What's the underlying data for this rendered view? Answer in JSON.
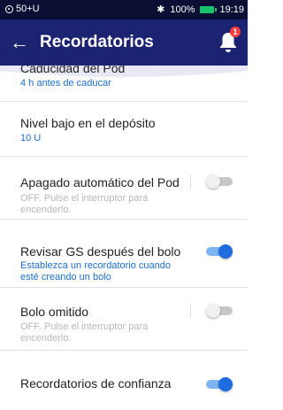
{
  "status_bar": {
    "left_text": "50+U",
    "bluetooth": "✱",
    "battery_pct": "100%",
    "time": "19:19",
    "accent": "#0b0f33"
  },
  "app_bar": {
    "title": "Recordatorios",
    "back_icon": "←",
    "notification_count": "1",
    "accent": "#1c2472"
  },
  "items": [
    {
      "title": "Caducidad del Pod",
      "subtitle": "4 h antes de caducar",
      "subtitle_color": "#1c6dd0"
    },
    {
      "title": "Nivel bajo en el depósito",
      "subtitle": "10 U",
      "subtitle_color": "#1c6dd0"
    },
    {
      "title": "Apagado automático del Pod",
      "subtitle": "OFF. Pulse el interruptor para encenderlo.",
      "toggle": "off"
    },
    {
      "title": "Revisar GS después del bolo",
      "subtitle": "Establezca un recordatorio cuando esté creando un bolo",
      "toggle": "on"
    },
    {
      "title": "Bolo omitido",
      "subtitle": "OFF. Pulse el interruptor para encenderlo.",
      "toggle": "off"
    },
    {
      "title": "Recordatorios de confianza",
      "toggle": "on"
    }
  ]
}
